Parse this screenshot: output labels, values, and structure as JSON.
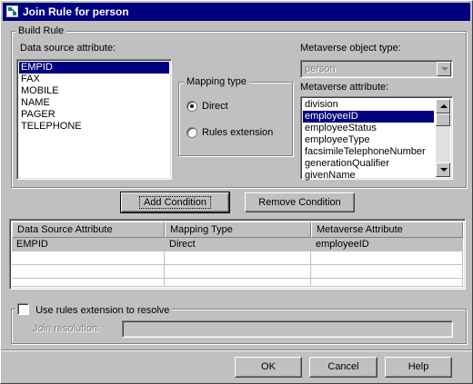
{
  "window": {
    "title": "Join Rule for person",
    "icon": "join-rule-icon"
  },
  "build_rule": {
    "group_label": "Build Rule",
    "data_source_label": "Data source attribute:",
    "data_source_items": [
      "EMPID",
      "FAX",
      "MOBILE",
      "NAME",
      "PAGER",
      "TELEPHONE"
    ],
    "data_source_selected": "EMPID",
    "mapping_type": {
      "label": "Mapping type",
      "options": [
        "Direct",
        "Rules extension"
      ],
      "selected": "Direct"
    },
    "metaverse_object_type_label": "Metaverse object type:",
    "metaverse_object_type_value": "person",
    "metaverse_attribute_label": "Metaverse attribute:",
    "metaverse_attribute_items": [
      "division",
      "employeeID",
      "employeeStatus",
      "employeeType",
      "facsimileTelephoneNumber",
      "generationQualifier",
      "givenName"
    ],
    "metaverse_attribute_selected": "employeeID"
  },
  "buttons": {
    "add_condition": "Add Condition",
    "remove_condition": "Remove Condition",
    "ok": "OK",
    "cancel": "Cancel",
    "help": "Help"
  },
  "conditions_table": {
    "columns": [
      "Data Source Attribute",
      "Mapping Type",
      "Metaverse Attribute"
    ],
    "rows": [
      [
        "EMPID",
        "Direct",
        "employeeID"
      ]
    ]
  },
  "resolution": {
    "checkbox_label": "Use rules extension to resolve",
    "checked": false,
    "join_resolution_label": "Join resolution:",
    "join_resolution_value": ""
  },
  "colors": {
    "title_bar": "#000080",
    "selection": "#000080",
    "face": "#c0c0c0"
  }
}
